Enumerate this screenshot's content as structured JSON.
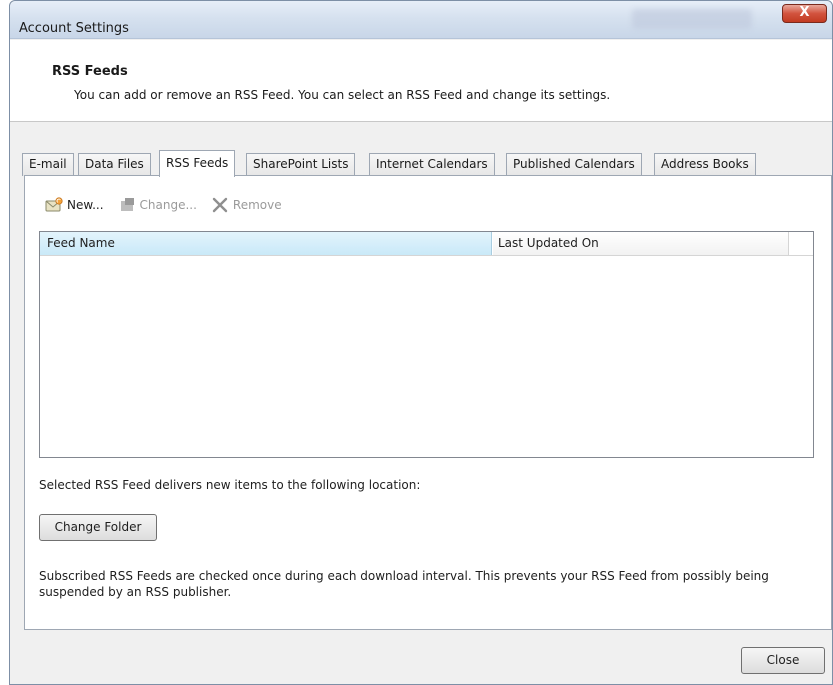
{
  "window": {
    "title": "Account Settings",
    "close_glyph": "X"
  },
  "header": {
    "title": "RSS Feeds",
    "description": "You can add or remove an RSS Feed. You can select an RSS Feed and change its settings."
  },
  "tabs": [
    {
      "label": "E-mail"
    },
    {
      "label": "Data Files"
    },
    {
      "label": "RSS Feeds",
      "active": true
    },
    {
      "label": "SharePoint Lists"
    },
    {
      "label": "Internet Calendars"
    },
    {
      "label": "Published Calendars"
    },
    {
      "label": "Address Books"
    }
  ],
  "toolbar": {
    "new_label": "New...",
    "change_label": "Change...",
    "remove_label": "Remove",
    "icons": {
      "new": "rss-new-icon",
      "change": "change-icon",
      "remove": "remove-x-icon"
    }
  },
  "list": {
    "columns": [
      "Feed Name",
      "Last Updated On"
    ],
    "rows": []
  },
  "location_text": "Selected RSS Feed delivers new items to the following location:",
  "change_folder_label": "Change Folder",
  "info_text": "Subscribed RSS Feeds are checked once during each download interval. This prevents your RSS Feed from possibly being suspended by an RSS publisher.",
  "close_label": "Close",
  "colors": {
    "selected_header": "#c9e9f8",
    "close_button_red": "#c23b22"
  }
}
